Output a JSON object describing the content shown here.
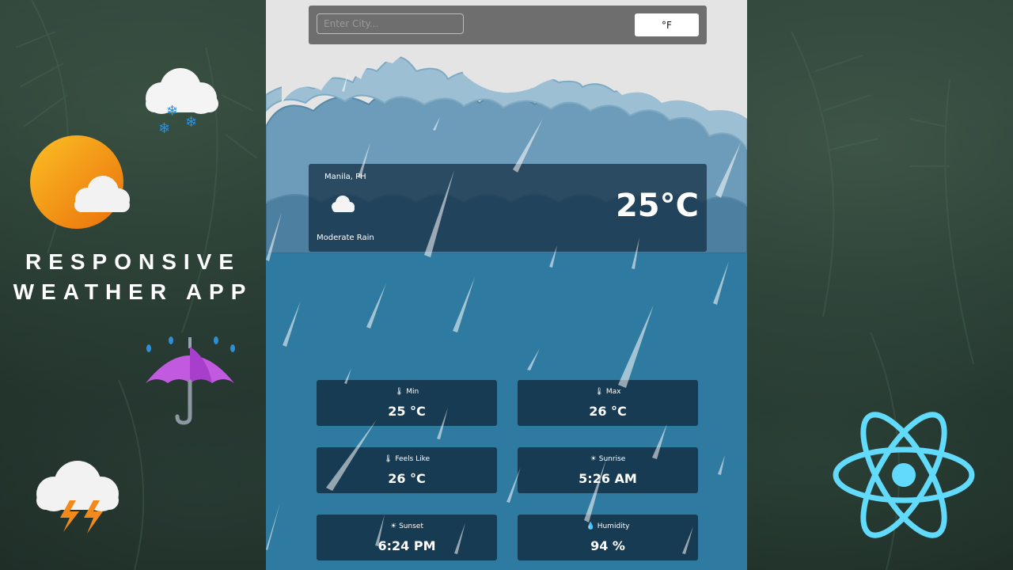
{
  "promo": {
    "title_line1": "RESPONSIVE",
    "title_line2": "WEATHER APP"
  },
  "search": {
    "placeholder": "Enter City...",
    "unit_toggle_label": "°F"
  },
  "current": {
    "city": "Manila, PH",
    "condition": "Moderate Rain",
    "temperature": "25°C",
    "icon": "rain-cloud-icon"
  },
  "stats": [
    {
      "label": "Min",
      "value": "25 °C",
      "icon": "thermometer-icon"
    },
    {
      "label": "Max",
      "value": "26 °C",
      "icon": "thermometer-icon"
    },
    {
      "label": "Feels Like",
      "value": "26 °C",
      "icon": "thermometer-icon"
    },
    {
      "label": "Sunrise",
      "value": "5:26 AM",
      "icon": "sunrise-icon"
    },
    {
      "label": "Sunset",
      "value": "6:24 PM",
      "icon": "sunset-icon"
    },
    {
      "label": "Humidity",
      "value": "94 %",
      "icon": "droplet-icon"
    }
  ],
  "side_icons": [
    "snow-cloud-icon",
    "sun-cloud-icon",
    "umbrella-icon",
    "storm-cloud-icon",
    "react-logo-icon"
  ],
  "colors": {
    "panel_blue": "#2f7aa0",
    "card_dark": "#122d41",
    "react_cyan": "#61dafb",
    "umbrella_purple": "#c25ae0",
    "sun_orange": "#f59e0b"
  }
}
